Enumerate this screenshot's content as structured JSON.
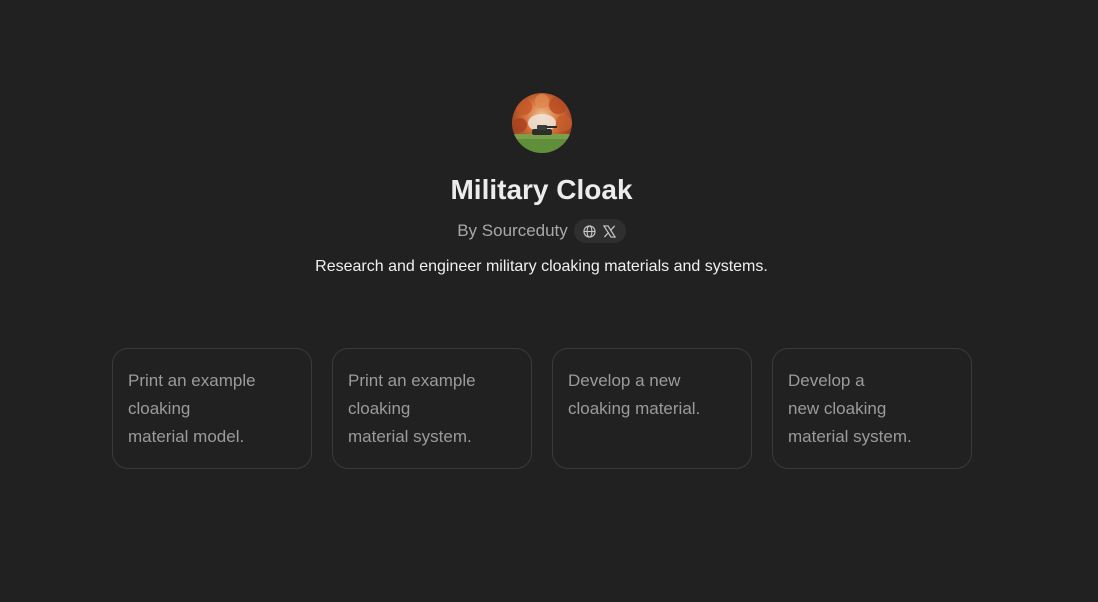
{
  "gpt": {
    "name": "Military Cloak",
    "author": "By Sourceduty",
    "description": "Research and engineer military cloaking materials and systems.",
    "avatar_icon": "military-cloak-avatar",
    "social_icons": [
      "globe-icon",
      "x-logo-icon"
    ]
  },
  "starters": [
    {
      "text": "Print an example\ncloaking\nmaterial model."
    },
    {
      "text": "Print an example\ncloaking\nmaterial system."
    },
    {
      "text": "Develop a new\ncloaking material."
    },
    {
      "text": "Develop a\nnew cloaking\nmaterial system."
    }
  ],
  "colors": {
    "background": "#212121",
    "title": "#ececec",
    "muted": "#a8a8a8",
    "card_border": "#3a3a3a",
    "pill": "#2f2f2f"
  }
}
